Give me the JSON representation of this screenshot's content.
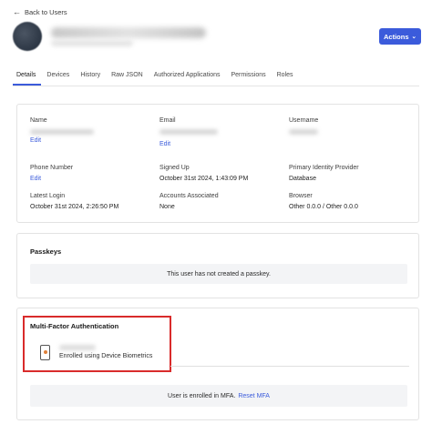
{
  "nav": {
    "back_label": "Back to Users",
    "back_icon": "arrow-left-icon"
  },
  "header": {
    "actions_label": "Actions",
    "accent": "#3b5bdb"
  },
  "tabs": [
    {
      "label": "Details",
      "active": true
    },
    {
      "label": "Devices"
    },
    {
      "label": "History"
    },
    {
      "label": "Raw JSON"
    },
    {
      "label": "Authorized Applications"
    },
    {
      "label": "Permissions"
    },
    {
      "label": "Roles"
    }
  ],
  "details": {
    "name": {
      "label": "Name",
      "edit": "Edit"
    },
    "email": {
      "label": "Email",
      "edit": "Edit"
    },
    "username": {
      "label": "Username"
    },
    "phone": {
      "label": "Phone Number",
      "edit": "Edit"
    },
    "signed_up": {
      "label": "Signed Up",
      "value": "October 31st 2024, 1:43:09 PM"
    },
    "identity_provider": {
      "label": "Primary Identity Provider",
      "value": "Database"
    },
    "latest_login": {
      "label": "Latest Login",
      "value": "October 31st 2024, 2:26:50 PM"
    },
    "accounts": {
      "label": "Accounts Associated",
      "value": "None"
    },
    "browser": {
      "label": "Browser",
      "value": "Other 0.0.0 / Other 0.0.0"
    }
  },
  "passkeys": {
    "title": "Passkeys",
    "empty": "This user has not created a passkey."
  },
  "mfa": {
    "title": "Multi-Factor Authentication",
    "enrollment": "Enrolled using Device Biometrics",
    "status": "User is enrolled in MFA.",
    "reset_label": "Reset MFA",
    "highlight_color": "#d92b2b"
  }
}
